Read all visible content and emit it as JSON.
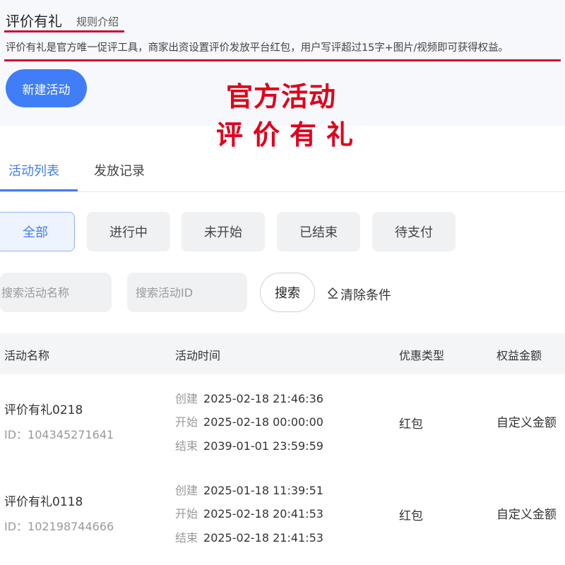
{
  "header": {
    "title": "评价有礼",
    "rules_link": "规则介绍",
    "description": "评价有礼是官方唯一促评工具，商家出资设置评价发放平台红包，用户写评超过15字+图片/视频即可获得权益。",
    "new_activity_button": "新建活动"
  },
  "overlay": {
    "line1": "官方活动",
    "line2": "评价有礼",
    "color": "#e0001b"
  },
  "tabs": [
    {
      "label": "活动列表",
      "active": true
    },
    {
      "label": "发放记录",
      "active": false
    }
  ],
  "filters": [
    {
      "label": "全部",
      "active": true
    },
    {
      "label": "进行中",
      "active": false
    },
    {
      "label": "未开始",
      "active": false
    },
    {
      "label": "已结束",
      "active": false
    },
    {
      "label": "待支付",
      "active": false
    }
  ],
  "search": {
    "name_placeholder": "搜索活动名称",
    "id_placeholder": "搜索活动ID",
    "search_button": "搜索",
    "clear_button": "清除条件"
  },
  "table": {
    "columns": [
      "活动名称",
      "活动时间",
      "优惠类型",
      "权益金额"
    ],
    "time_labels": {
      "created": "创建",
      "start": "开始",
      "end": "结束"
    },
    "rows": [
      {
        "name": "评价有礼0218",
        "id": "ID：104345271641",
        "created": "2025-02-18 21:46:36",
        "start": "2025-02-18 00:00:00",
        "end": "2039-01-01 23:59:59",
        "type": "红包",
        "amount": "自定义金额"
      },
      {
        "name": "评价有礼0118",
        "id": "ID：102198744666",
        "created": "2025-01-18 11:39:51",
        "start": "2025-02-18 20:41:53",
        "end": "2025-02-18 21:41:53",
        "type": "红包",
        "amount": "自定义金额"
      }
    ]
  },
  "colors": {
    "accent": "#3f7ef7",
    "annotation_red": "#c8102e"
  }
}
